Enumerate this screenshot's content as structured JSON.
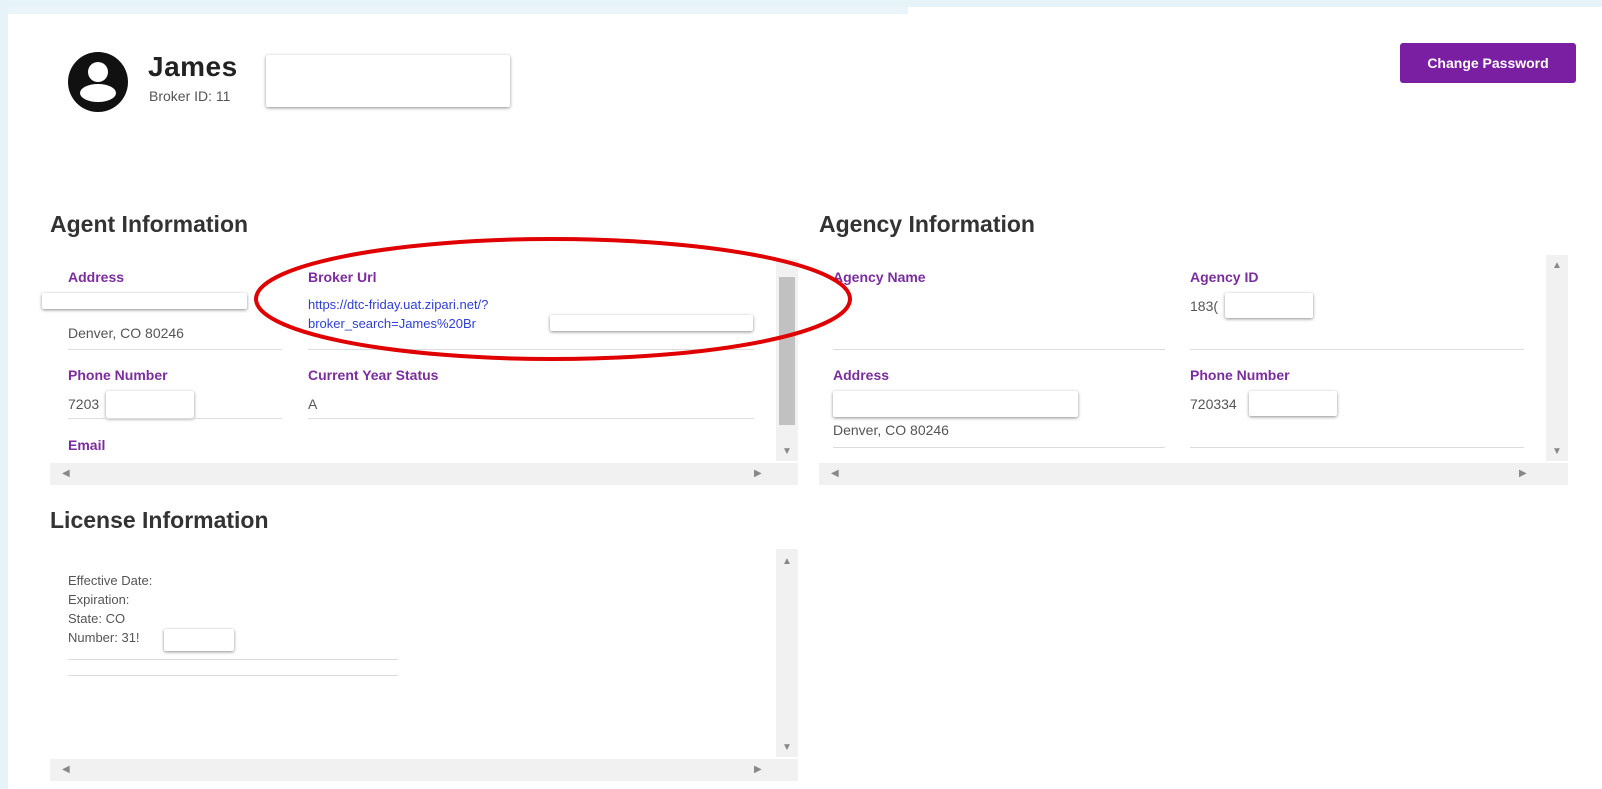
{
  "header": {
    "user_name": "James",
    "broker_id": "Broker ID: 11",
    "change_password_label": "Change Password"
  },
  "agent": {
    "title": "Agent Information",
    "address_label": "Address",
    "address_city": "Denver, CO 80246",
    "broker_url_label": "Broker Url",
    "broker_url_line1": "https://dtc-friday.uat.zipari.net/?",
    "broker_url_line2": "broker_search=James%20Br",
    "phone_label": "Phone Number",
    "phone_value": "7203",
    "status_label": "Current Year Status",
    "status_value": "A",
    "email_label": "Email"
  },
  "agency": {
    "title": "Agency Information",
    "name_label": "Agency Name",
    "id_label": "Agency ID",
    "id_value": "183(",
    "address_label": "Address",
    "address_city": "Denver, CO 80246",
    "phone_label": "Phone Number",
    "phone_value": "720334"
  },
  "license": {
    "title": "License Information",
    "effective": "Effective Date:",
    "expiration": "Expiration:",
    "state": "State: CO",
    "number": "Number: 31!"
  },
  "colors": {
    "accent": "#7b1fa2",
    "label": "#7b2d9e",
    "link": "#2f3fd6",
    "annotation": "#e00000"
  }
}
